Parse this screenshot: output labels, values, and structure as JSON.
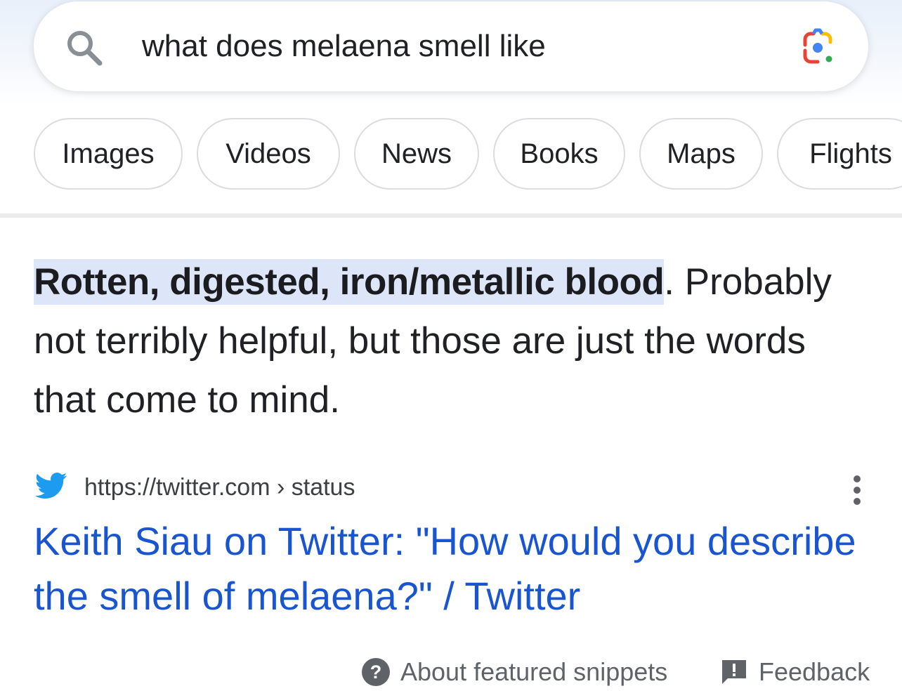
{
  "search": {
    "query": "what does melaena smell like"
  },
  "chips": [
    {
      "label": "Images"
    },
    {
      "label": "Videos"
    },
    {
      "label": "News"
    },
    {
      "label": "Books"
    },
    {
      "label": "Maps"
    },
    {
      "label": "Flights"
    }
  ],
  "snippet": {
    "highlight": "Rotten, digested, iron/metallic blood",
    "highlight_end": ".",
    "body": " Probably not terribly helpful, but those are just the words that come to mind."
  },
  "result": {
    "source_icon": "twitter-bird-icon",
    "url": "https://twitter.com › status",
    "title": "Keith Siau on Twitter: \"How would you describe the smell of melaena?\" / Twitter"
  },
  "footer": {
    "about_label": "About featured snippets",
    "feedback_label": "Feedback"
  },
  "colors": {
    "link": "#1a55d1",
    "highlight": "#dde6f9",
    "twitter": "#1d9bf0"
  }
}
